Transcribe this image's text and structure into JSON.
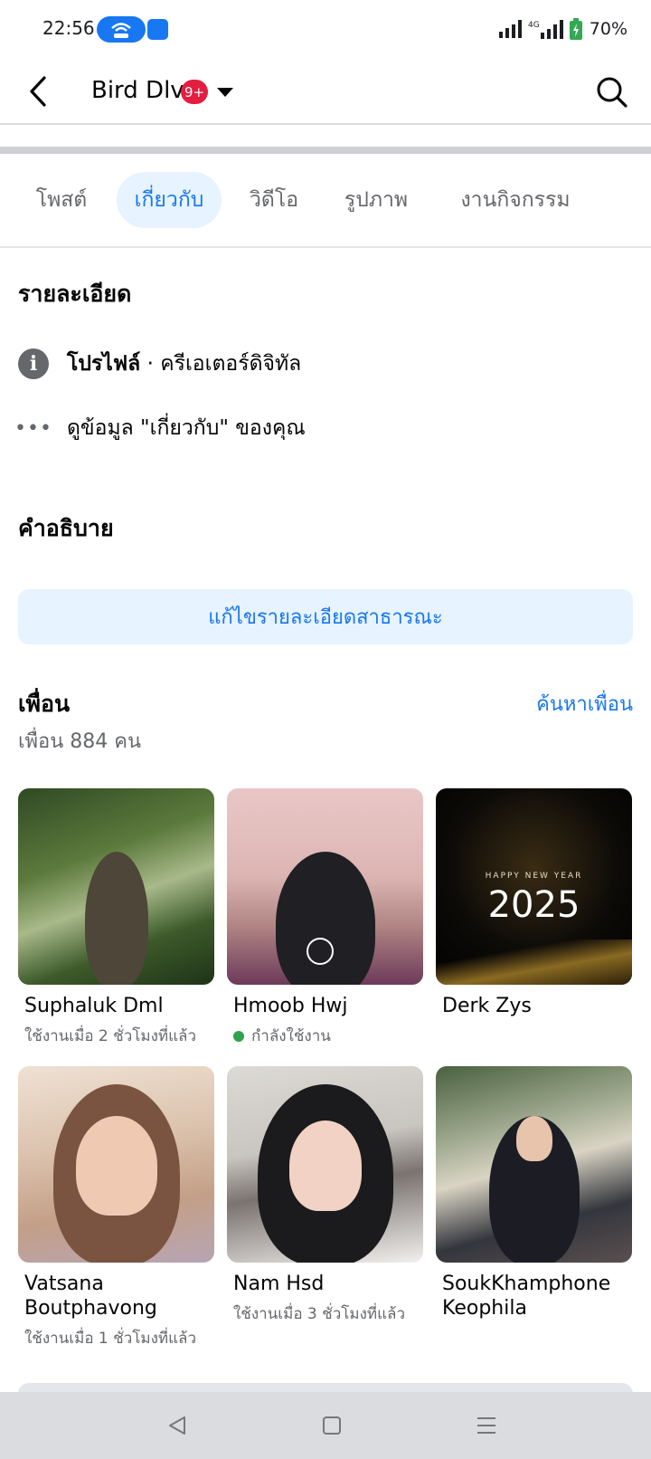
{
  "status_bar": {
    "time": "22:56",
    "network": "4G",
    "battery": "70%",
    "icons": [
      "hotspot-icon",
      "app-notification-icon",
      "signal-icon",
      "signal-4g-icon",
      "battery-charging-icon"
    ]
  },
  "header": {
    "profile_name": "Bird Dlv",
    "notification_badge": "9+",
    "icons": [
      "back-arrow-icon",
      "caret-down-icon",
      "search-icon"
    ]
  },
  "tabs": [
    {
      "label": "โพสต์",
      "active": false
    },
    {
      "label": "เกี่ยวกับ",
      "active": true
    },
    {
      "label": "วิดีโอ",
      "active": false
    },
    {
      "label": "รูปภาพ",
      "active": false
    },
    {
      "label": "งานกิจกรรม",
      "active": false
    }
  ],
  "details": {
    "title": "รายละเอียด",
    "profile_label": "โปรไฟล์",
    "profile_separator": " · ",
    "profile_category": "ครีเอเตอร์ดิจิทัล",
    "about_link": "ดูข้อมูล \"เกี่ยวกับ\" ของคุณ"
  },
  "description": {
    "title": "คำอธิบาย",
    "edit_button": "แก้ไขรายละเอียดสาธารณะ"
  },
  "friends": {
    "title": "เพื่อน",
    "find_link": "ค้นหาเพื่อน",
    "count_text": "เพื่อน 884 คน",
    "list": [
      {
        "name": "Suphaluk Dml",
        "status": "ใช้งานเมื่อ 2 ชั่วโมงที่แล้ว",
        "online": false
      },
      {
        "name": "Hmoob Hwj",
        "status": "กำลังใช้งาน",
        "online": true
      },
      {
        "name": "Derk Zys",
        "status": "",
        "online": false
      },
      {
        "name": "Vatsana Boutphavong",
        "status": "ใช้งานเมื่อ 1 ชั่วโมงที่แล้ว",
        "online": false
      },
      {
        "name": "Nam Hsd",
        "status": "ใช้งานเมื่อ 3 ชั่วโมงที่แล้ว",
        "online": false
      },
      {
        "name": "SoukKhamphone Keophila",
        "status": "",
        "online": false
      }
    ],
    "photo_texts": {
      "new_year_small": "HAPPY NEW YEAR",
      "new_year_big": "2025"
    }
  },
  "colors": {
    "accent": "#1877f2",
    "accent_bg": "#e7f3ff",
    "badge": "#e41e3f",
    "online": "#31a24c",
    "secondary_text": "#65676b"
  }
}
